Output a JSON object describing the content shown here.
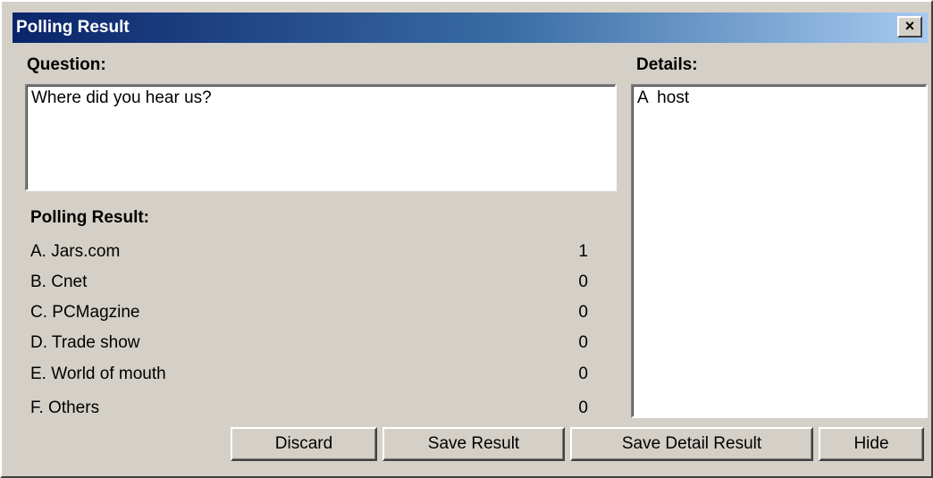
{
  "window": {
    "title": "Polling Result",
    "close_label": "×"
  },
  "question": {
    "label": "Question:",
    "value": "Where did you hear us?"
  },
  "details": {
    "label": "Details:",
    "value": "A  host"
  },
  "polling_result": {
    "label": "Polling Result:",
    "options": [
      {
        "label": "A. Jars.com",
        "count": "1"
      },
      {
        "label": "B. Cnet",
        "count": "0"
      },
      {
        "label": "C. PCMagzine",
        "count": "0"
      },
      {
        "label": "D. Trade show",
        "count": "0"
      },
      {
        "label": "E. World of mouth",
        "count": "0"
      },
      {
        "label": "F. Others",
        "count": "0"
      }
    ]
  },
  "buttons": {
    "discard": "Discard",
    "save_result": "Save Result",
    "save_detail_result": "Save Detail Result",
    "hide": "Hide"
  },
  "colors": {
    "title_gradient_start": "#0a246a",
    "title_gradient_end": "#a6caf0",
    "dialog_face": "#d4d0c8"
  }
}
